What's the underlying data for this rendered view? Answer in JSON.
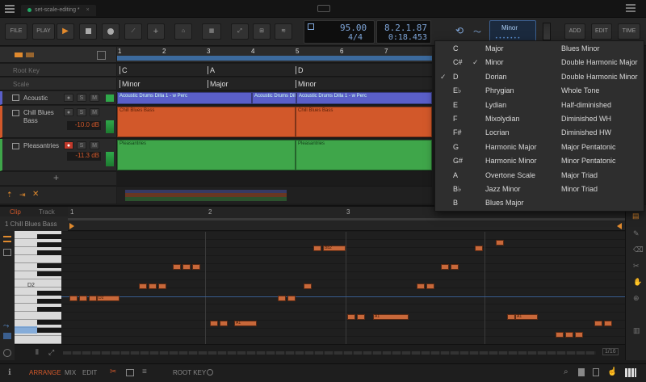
{
  "tab": {
    "label": "set-scale-editing *"
  },
  "toolbar": {
    "file": "FILE",
    "play": "PLAY",
    "add": "ADD",
    "edit": "EDIT",
    "time": "TIME",
    "tempo": "95.00",
    "signature": "4/4",
    "position": "8.2.1.87",
    "time_pos": "0:18.453",
    "scale_display": "Minor"
  },
  "arranger": {
    "ruler": [
      "1",
      "2",
      "3",
      "4",
      "5",
      "6",
      "7"
    ],
    "root_key_label": "Root Key",
    "scale_label": "Scale",
    "root_keys": [
      "C",
      "A",
      "D"
    ],
    "scales": [
      "Minor",
      "Major",
      "Minor"
    ],
    "tracks": [
      {
        "name": "Acoustic",
        "db": "",
        "color": "#5a5fc8"
      },
      {
        "name": "Chill Blues Bass",
        "db": "-10.0 dB",
        "color": "#d2582a"
      },
      {
        "name": "Pleasantries",
        "db": "-11.3 dB",
        "color": "#3fa64a"
      }
    ],
    "clips": {
      "acoustic": [
        "Acoustic Drums Dilla 1 - w Perc",
        "Acoustic Drums Dilla 1 - w Perc",
        "Acoustic Drums Dilla 1 - w Perc"
      ],
      "bass": [
        "Chill Blues Bass",
        "Chill Blues Bass"
      ],
      "pleasant": [
        "Pleasantries",
        "Pleasantries"
      ]
    },
    "add_track": "+"
  },
  "editor": {
    "tabs": [
      "Clip",
      "Track"
    ],
    "clip_name": "1  Chill Blues Bass",
    "ruler": [
      "1",
      "2",
      "3"
    ],
    "key_label": "D2",
    "note_labels": [
      "D2",
      "Bb2",
      "A1",
      "A1",
      "A1"
    ]
  },
  "footer": {
    "arrange": "ARRANGE",
    "mix": "MIX",
    "edit": "EDIT",
    "root_key": "ROOT KEY",
    "page": "1/16"
  },
  "menu": {
    "keys": [
      "C",
      "C#",
      "D",
      "E♭",
      "E",
      "F",
      "F#",
      "G",
      "G#",
      "A",
      "B♭",
      "B"
    ],
    "scales_col1": [
      "Major",
      "Minor",
      "Dorian",
      "Phrygian",
      "Lydian",
      "Mixolydian",
      "Locrian",
      "Harmonic Major",
      "Harmonic Minor",
      "Overtone Scale",
      "Jazz Minor",
      "Blues Major"
    ],
    "scales_col2": [
      "Blues Minor",
      "Double Harmonic Major",
      "Double Harmonic Minor",
      "Whole Tone",
      "Half-diminished",
      "Diminished WH",
      "Diminished HW",
      "Major Pentatonic",
      "Minor Pentatonic",
      "Major Triad",
      "Minor Triad"
    ],
    "checked_key": "D",
    "checked_scale": "Minor"
  },
  "colors": {
    "accent": "#d2582a",
    "blue": "#5a5fc8",
    "green": "#3fa64a",
    "note": "#c8683a"
  }
}
